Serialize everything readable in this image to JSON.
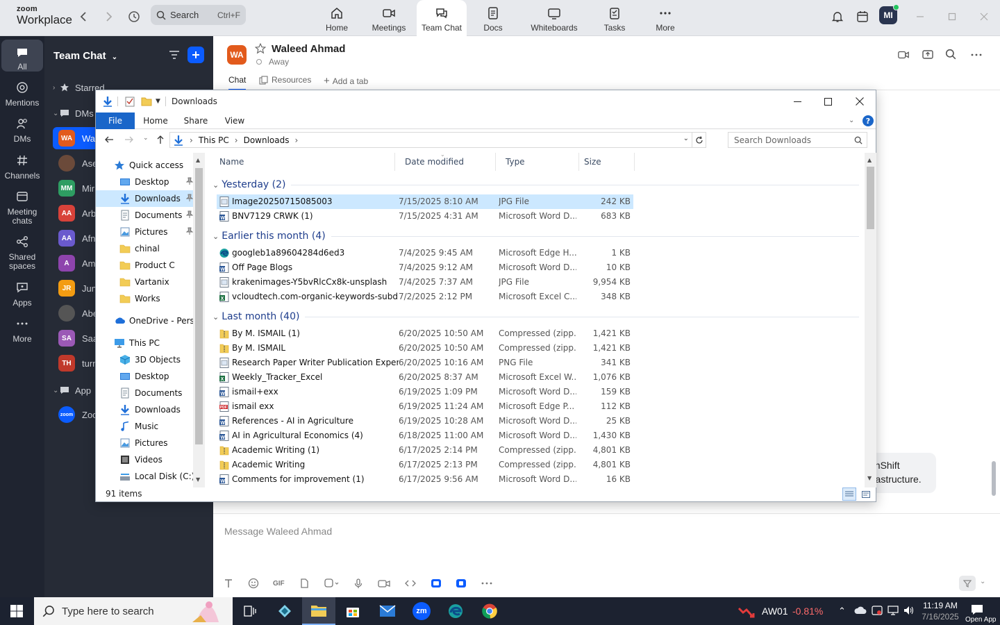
{
  "zoom": {
    "brand_line1": "zoom",
    "brand_line2": "Workplace",
    "search_label": "Search",
    "search_shortcut": "Ctrl+F",
    "nav": [
      {
        "label": "Home",
        "icon": "home-icon"
      },
      {
        "label": "Meetings",
        "icon": "video-icon"
      },
      {
        "label": "Team Chat",
        "icon": "chat-icon",
        "active": true
      },
      {
        "label": "Docs",
        "icon": "doc-icon"
      },
      {
        "label": "Whiteboards",
        "icon": "whiteboard-icon"
      },
      {
        "label": "Tasks",
        "icon": "tasks-icon"
      },
      {
        "label": "More",
        "icon": "more-icon"
      }
    ],
    "profile_initials": "MI",
    "rail": [
      {
        "label": "All",
        "active": true
      },
      {
        "label": "Mentions"
      },
      {
        "label": "DMs"
      },
      {
        "label": "Channels"
      },
      {
        "label": "Meeting chats"
      },
      {
        "label": "Shared spaces"
      },
      {
        "label": "Apps"
      },
      {
        "label": "More"
      }
    ],
    "chat_panel_title": "Team Chat",
    "starred_label": "Starred",
    "dms_label": "DMs",
    "apps_label": "App",
    "dm_list": [
      {
        "initials": "WA",
        "name": "Wa",
        "color": "#e25a1c",
        "active": true
      },
      {
        "initials": "",
        "name": "Ase",
        "color": "#6b4a3a"
      },
      {
        "initials": "MM",
        "name": "Mir",
        "color": "#2e9d62"
      },
      {
        "initials": "AA",
        "name": "Arb",
        "color": "#d8423a"
      },
      {
        "initials": "AA",
        "name": "Afn",
        "color": "#6a5acd"
      },
      {
        "initials": "A",
        "name": "Am",
        "color": "#8e44ad"
      },
      {
        "initials": "JR",
        "name": "Jun",
        "color": "#f39c12"
      },
      {
        "initials": "",
        "name": "Abe",
        "color": "#555"
      },
      {
        "initials": "SA",
        "name": "Saa",
        "color": "#9b59b6"
      },
      {
        "initials": "TH",
        "name": "turn",
        "color": "#c0392b"
      }
    ],
    "app_item": {
      "initials": "zoom",
      "name": "Zoo",
      "color": "#0b5cff"
    },
    "contact": {
      "initials": "WA",
      "name": "Waleed Ahmad",
      "status": "Away"
    },
    "conv_tabs": {
      "chat": "Chat",
      "resources": "Resources",
      "add": "Add a tab"
    },
    "message_partial_line1": "enShift",
    "message_partial_line2": "frastructure.",
    "composer_placeholder": "Message Waleed Ahmad"
  },
  "explorer": {
    "title": "Downloads",
    "ribbon_tabs": [
      "File",
      "Home",
      "Share",
      "View"
    ],
    "breadcrumb": [
      "This PC",
      "Downloads"
    ],
    "search_placeholder": "Search Downloads",
    "nav": [
      {
        "label": "Quick access",
        "icon": "star",
        "level": 0
      },
      {
        "label": "Desktop",
        "icon": "desktop",
        "level": 1,
        "pinned": true
      },
      {
        "label": "Downloads",
        "icon": "download",
        "level": 1,
        "pinned": true,
        "selected": true
      },
      {
        "label": "Documents",
        "icon": "documents",
        "level": 1,
        "pinned": true
      },
      {
        "label": "Pictures",
        "icon": "pictures",
        "level": 1,
        "pinned": true
      },
      {
        "label": "chinal",
        "icon": "folder",
        "level": 1
      },
      {
        "label": "Product C",
        "icon": "folder",
        "level": 1
      },
      {
        "label": "Vartanix",
        "icon": "folder",
        "level": 1
      },
      {
        "label": "Works",
        "icon": "folder",
        "level": 1
      },
      {
        "label": "OneDrive - Persor",
        "icon": "cloud",
        "level": 0,
        "gap": true
      },
      {
        "label": "This PC",
        "icon": "pc",
        "level": 0,
        "gap": true
      },
      {
        "label": "3D Objects",
        "icon": "cube",
        "level": 1
      },
      {
        "label": "Desktop",
        "icon": "desktop",
        "level": 1
      },
      {
        "label": "Documents",
        "icon": "documents",
        "level": 1
      },
      {
        "label": "Downloads",
        "icon": "download",
        "level": 1
      },
      {
        "label": "Music",
        "icon": "music",
        "level": 1
      },
      {
        "label": "Pictures",
        "icon": "pictures",
        "level": 1
      },
      {
        "label": "Videos",
        "icon": "videos",
        "level": 1
      },
      {
        "label": "Local Disk (C:)",
        "icon": "disk",
        "level": 1
      }
    ],
    "columns": [
      "Name",
      "Date modified",
      "Type",
      "Size"
    ],
    "groups": [
      {
        "label": "Yesterday (2)",
        "files": [
          {
            "name": "Image20250715085003",
            "date": "7/15/2025 8:10 AM",
            "type": "JPG File",
            "size": "242 KB",
            "icon": "img",
            "selected": true
          },
          {
            "name": "BNV7129 CRWK (1)",
            "date": "7/15/2025 4:31 AM",
            "type": "Microsoft Word D...",
            "size": "683 KB",
            "icon": "word"
          }
        ]
      },
      {
        "label": "Earlier this month (4)",
        "files": [
          {
            "name": "googleb1a89604284d6ed3",
            "date": "7/4/2025 9:45 AM",
            "type": "Microsoft Edge H...",
            "size": "1 KB",
            "icon": "edge"
          },
          {
            "name": "Off Page Blogs",
            "date": "7/4/2025 9:12 AM",
            "type": "Microsoft Word D...",
            "size": "10 KB",
            "icon": "word"
          },
          {
            "name": "krakenimages-Y5bvRlcCx8k-unsplash",
            "date": "7/4/2025 7:37 AM",
            "type": "JPG File",
            "size": "9,954 KB",
            "icon": "img"
          },
          {
            "name": "vcloudtech.com-organic-keywords-subd...",
            "date": "7/2/2025 2:12 PM",
            "type": "Microsoft Excel C...",
            "size": "348 KB",
            "icon": "excel"
          }
        ]
      },
      {
        "label": "Last month (40)",
        "files": [
          {
            "name": "By M. ISMAIL (1)",
            "date": "6/20/2025 10:50 AM",
            "type": "Compressed (zipp...",
            "size": "1,421 KB",
            "icon": "zip"
          },
          {
            "name": "By M. ISMAIL",
            "date": "6/20/2025 10:50 AM",
            "type": "Compressed (zipp...",
            "size": "1,421 KB",
            "icon": "zip"
          },
          {
            "name": "Research Paper Writer Publication Expert",
            "date": "6/20/2025 10:16 AM",
            "type": "PNG File",
            "size": "341 KB",
            "icon": "img"
          },
          {
            "name": "Weekly_Tracker_Excel",
            "date": "6/20/2025 8:37 AM",
            "type": "Microsoft Excel W...",
            "size": "1,076 KB",
            "icon": "excel"
          },
          {
            "name": "ismail+exx",
            "date": "6/19/2025 1:09 PM",
            "type": "Microsoft Word D...",
            "size": "159 KB",
            "icon": "word"
          },
          {
            "name": "ismail exx",
            "date": "6/19/2025 11:24 AM",
            "type": "Microsoft Edge P...",
            "size": "112 KB",
            "icon": "pdf"
          },
          {
            "name": "References - AI in Agriculture",
            "date": "6/19/2025 10:28 AM",
            "type": "Microsoft Word D...",
            "size": "25 KB",
            "icon": "word"
          },
          {
            "name": "AI in Agricultural Economics (4)",
            "date": "6/18/2025 11:00 AM",
            "type": "Microsoft Word D...",
            "size": "1,430 KB",
            "icon": "word"
          },
          {
            "name": "Academic Writing (1)",
            "date": "6/17/2025 2:14 PM",
            "type": "Compressed (zipp...",
            "size": "4,801 KB",
            "icon": "zip"
          },
          {
            "name": "Academic Writing",
            "date": "6/17/2025 2:13 PM",
            "type": "Compressed (zipp...",
            "size": "4,801 KB",
            "icon": "zip"
          },
          {
            "name": "Comments for improvement (1)",
            "date": "6/17/2025 9:56 AM",
            "type": "Microsoft Word D...",
            "size": "16 KB",
            "icon": "word"
          }
        ]
      }
    ],
    "status": "91 items"
  },
  "taskbar": {
    "search_placeholder": "Type here to search",
    "stock_name": "AW01",
    "stock_change": "-0.81%",
    "time": "11:19 AM",
    "date": "7/16/2025",
    "corner_text": "Open App"
  }
}
